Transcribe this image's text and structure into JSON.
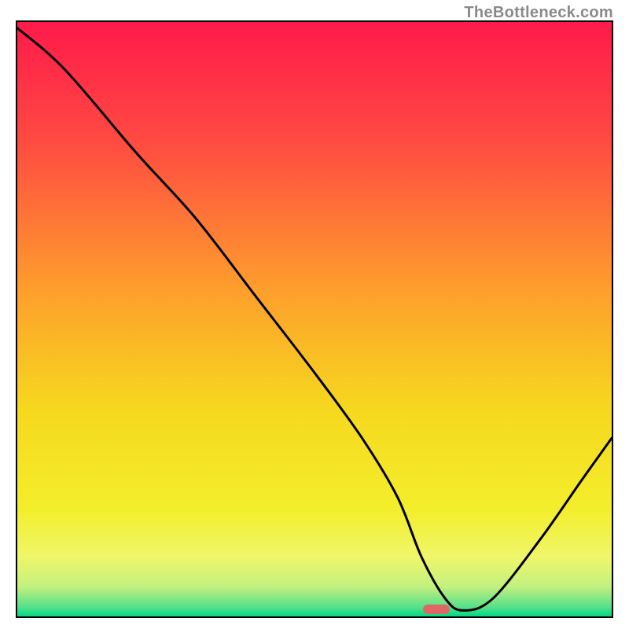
{
  "watermark": "TheBottleneck.com",
  "chart_data": {
    "type": "line",
    "title": "",
    "xlabel": "",
    "ylabel": "",
    "xlim": [
      0,
      100
    ],
    "ylim": [
      0,
      100
    ],
    "grid": false,
    "legend": false,
    "background_gradient": {
      "stops": [
        {
          "pos": 0.0,
          "color": "#ff1a4b"
        },
        {
          "pos": 0.2,
          "color": "#ff4a42"
        },
        {
          "pos": 0.45,
          "color": "#fe9e2c"
        },
        {
          "pos": 0.65,
          "color": "#f6d81e"
        },
        {
          "pos": 0.82,
          "color": "#f3ee2b"
        },
        {
          "pos": 0.9,
          "color": "#eff66a"
        },
        {
          "pos": 0.95,
          "color": "#c3f07f"
        },
        {
          "pos": 0.985,
          "color": "#54e08a"
        },
        {
          "pos": 1.0,
          "color": "#00d886"
        }
      ]
    },
    "series": [
      {
        "name": "bottleneck-curve",
        "x": [
          0,
          8,
          20,
          30,
          40,
          50,
          58,
          64,
          68,
          72,
          75,
          80,
          88,
          95,
          100
        ],
        "y": [
          99,
          92,
          78,
          67,
          54,
          41,
          30,
          20,
          10,
          3,
          1,
          3,
          13,
          23,
          30
        ]
      }
    ],
    "marker": {
      "x": 70.5,
      "y": 1.2,
      "width": 4.5,
      "height": 1.6,
      "color": "#e06666"
    }
  }
}
